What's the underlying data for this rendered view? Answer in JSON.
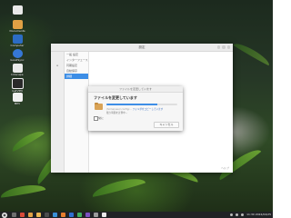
{
  "desktop": {
    "icons": [
      {
        "label": "",
        "color": "#e8e8e8"
      },
      {
        "label": "Documents",
        "color": "#e0a144"
      },
      {
        "label": "Computer",
        "color": "#2c6cc4"
      },
      {
        "label": "GoodSync",
        "color": "#3677d6"
      },
      {
        "label": "Inkscape",
        "color": "#eaeaea"
      },
      {
        "label": "GetVPN",
        "color": "#2a2a2a"
      },
      {
        "label": "MPV",
        "color": "#f0f0f0"
      }
    ]
  },
  "window": {
    "title": "設定",
    "nav_items": [
      "一般 設定",
      "インターフェース",
      "同期設定",
      "自動保存",
      "詳細"
    ],
    "active_nav_index": 4,
    "help_label": "ヘルプ"
  },
  "dialog": {
    "title": "ファイルを変更しています",
    "heading": "ファイルを変更しています",
    "detail_path": "/home/user/.config/...",
    "detail_selected": "フォルダをコピーしています",
    "extra_text": "残り時間を計算中...",
    "progress": 0.72,
    "checkbox_label": "常に",
    "cancel_label": "キャンセル"
  },
  "taskbar": {
    "start_glyph": "◉",
    "apps": [
      {
        "name": "files",
        "color": "#6e6e6e"
      },
      {
        "name": "browser-red",
        "color": "#d84b3a"
      },
      {
        "name": "mail",
        "color": "#e0a144"
      },
      {
        "name": "folder",
        "color": "#e9b650"
      },
      {
        "name": "terminal",
        "color": "#4c4c4c"
      },
      {
        "name": "writer",
        "color": "#3a8fd6"
      },
      {
        "name": "media-orange",
        "color": "#e67d2c"
      },
      {
        "name": "app-blue",
        "color": "#2f6fd0"
      },
      {
        "name": "app-green",
        "color": "#3fae5a"
      },
      {
        "name": "app-purple",
        "color": "#7a4fbf"
      },
      {
        "name": "app-gray",
        "color": "#9a9a9a"
      },
      {
        "name": "app-white",
        "color": "#e8e8e8"
      }
    ],
    "clock": "11:30 2024/04/25"
  }
}
